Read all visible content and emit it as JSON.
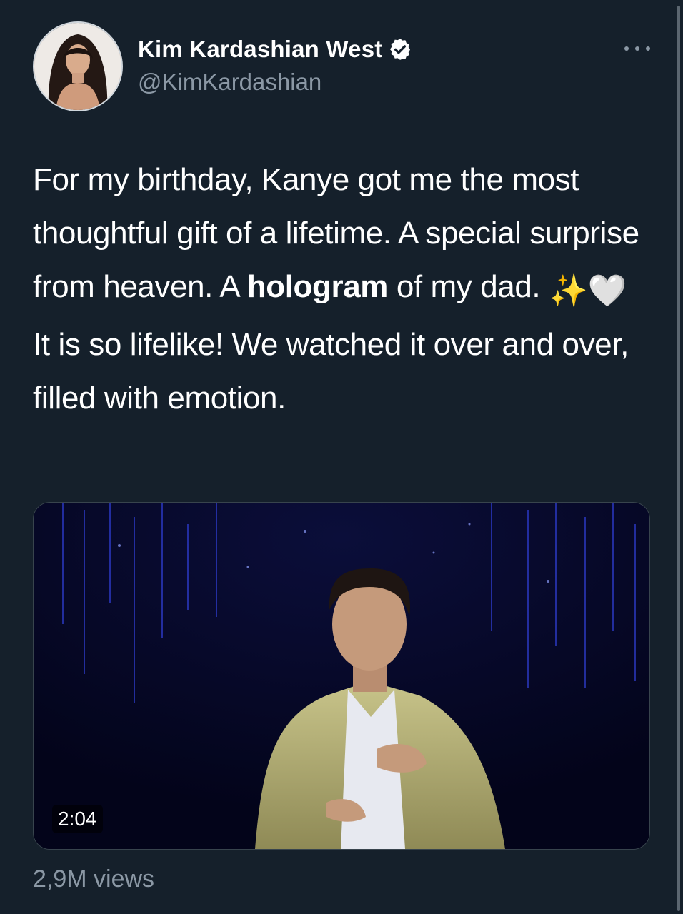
{
  "author": {
    "display_name": "Kim Kardashian West",
    "handle": "@KimKardashian",
    "verified": true,
    "avatar_icon": "profile-photo"
  },
  "tweet": {
    "text_part1": "For my birthday, Kanye got me the most thoughtful gift of a lifetime. A special surprise from heaven. A ",
    "text_bold": "hologram",
    "text_part2": " of my dad. ",
    "emoji_sparkles": "✨",
    "emoji_heart": "🤍",
    "text_part3": " It is so lifelike! We watched it over and over, filled with emotion."
  },
  "media": {
    "type": "video",
    "duration": "2:04"
  },
  "stats": {
    "views": "2,9M views"
  },
  "colors": {
    "background": "#15202b",
    "secondary_text": "#8b98a5",
    "verified_badge": "#ffffff"
  }
}
